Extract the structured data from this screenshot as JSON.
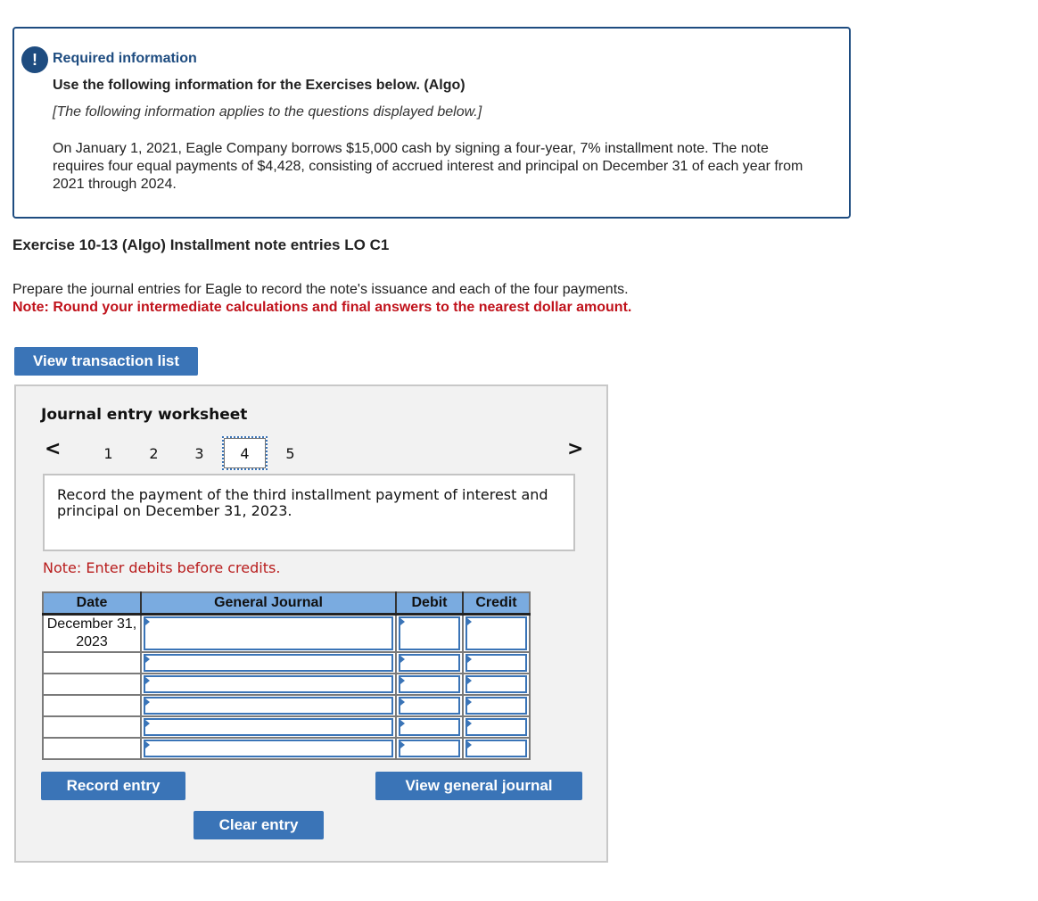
{
  "required_info": {
    "badge": "!",
    "title": "Required information",
    "subtitle": "Use the following information for the Exercises below. (Algo)",
    "applies": "[The following information applies to the questions displayed below.]",
    "body": "On January 1, 2021, Eagle Company borrows $15,000 cash by signing a four-year, 7% installment note. The note requires four equal payments of $4,428, consisting of accrued interest and principal on December 31 of each year from 2021 through 2024."
  },
  "exercise": {
    "title": "Exercise 10-13 (Algo) Installment note entries LO C1",
    "instructions": "Prepare the journal entries for Eagle to record the note's issuance and each of the four payments.",
    "note": "Note: Round your intermediate calculations and final answers to the nearest dollar amount."
  },
  "buttons": {
    "view_transaction_list": "View transaction list",
    "record_entry": "Record entry",
    "clear_entry": "Clear entry",
    "view_general_journal": "View general journal"
  },
  "worksheet": {
    "title": "Journal entry worksheet",
    "prev_icon": "‹",
    "next_icon": "›",
    "tabs": [
      "1",
      "2",
      "3",
      "4",
      "5"
    ],
    "active_tab": "4",
    "description": "Record the payment of the third installment payment of interest and principal on December 31, 2023.",
    "note": "Note: Enter debits before credits.",
    "table": {
      "headers": [
        "Date",
        "General Journal",
        "Debit",
        "Credit"
      ],
      "rows": [
        {
          "date": "December 31, 2023",
          "account": "",
          "debit": "",
          "credit": ""
        },
        {
          "date": "",
          "account": "",
          "debit": "",
          "credit": ""
        },
        {
          "date": "",
          "account": "",
          "debit": "",
          "credit": ""
        },
        {
          "date": "",
          "account": "",
          "debit": "",
          "credit": ""
        },
        {
          "date": "",
          "account": "",
          "debit": "",
          "credit": ""
        },
        {
          "date": "",
          "account": "",
          "debit": "",
          "credit": ""
        }
      ]
    }
  },
  "colors": {
    "brand_blue": "#1e4c80",
    "button_blue": "#3a74b7",
    "header_blue": "#7aabe0",
    "note_red": "#c0121b"
  }
}
